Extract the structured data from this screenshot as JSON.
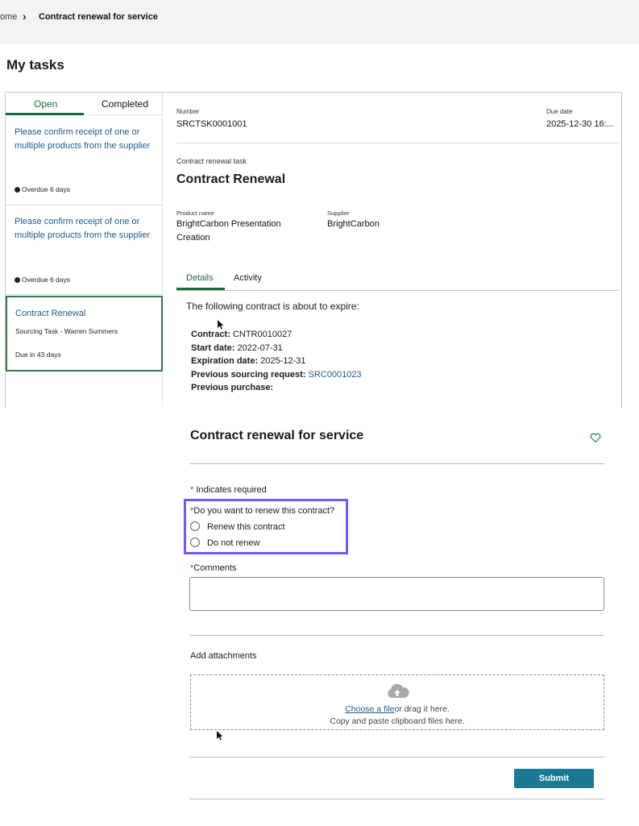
{
  "breadcrumb": {
    "home": "Home",
    "current": "Contract renewal for service"
  },
  "page_title": "My tasks",
  "tabs": {
    "open": "Open",
    "completed": "Completed"
  },
  "tasks": [
    {
      "title": "Please confirm receipt of one or multiple products from the supplier",
      "meta": "Overdue 6 days"
    },
    {
      "title": "Please confirm receipt of one or multiple products from the supplier",
      "meta": "Overdue 6 days"
    },
    {
      "title": "Contract Renewal",
      "subtitle": "Sourcing Task - Warren Summers",
      "meta": "Due in 43 days"
    }
  ],
  "detail": {
    "number_label": "Number",
    "number": "SRCTSK0001001",
    "due_label": "Due date",
    "due": "2025-12-30 16:...",
    "task_type": "Contract renewal task",
    "title": "Contract Renewal",
    "product_label": "Product name",
    "product_line1": "BrightCarbon Presentation",
    "product_line2": "Creation",
    "supplier_label": "Supplier",
    "supplier": "BrightCarbon",
    "tab_details": "Details",
    "tab_activity": "Activity",
    "intro": "The following contract is about to expire:",
    "contract_label": "Contract:",
    "contract": "CNTR0010027",
    "start_label": "Start date:",
    "start": "2022-07-31",
    "exp_label": "Expiration date:",
    "exp": "2025-12-31",
    "prev_req_label": "Previous sourcing request:",
    "prev_req": "SRC0001023",
    "prev_purchase_label": "Previous purchase:"
  },
  "form": {
    "title": "Contract renewal for service",
    "required_note": "Indicates required",
    "question": "Do you want to renew this contract?",
    "option1": "Renew this contract",
    "option2": "Do not renew",
    "comments_label": "Comments",
    "attachments_label": "Add attachments",
    "choose_file": "Choose a file",
    "drag_text": "or drag it here.",
    "paste_text": "Copy and paste clipboard files here.",
    "submit": "Submit"
  },
  "colors": {
    "accent_green": "#1d6b3a",
    "link_blue": "#1f5a8c",
    "submit_teal": "#1a7a95",
    "highlight": "#6a5ef5",
    "required_red": "#c0282d"
  }
}
